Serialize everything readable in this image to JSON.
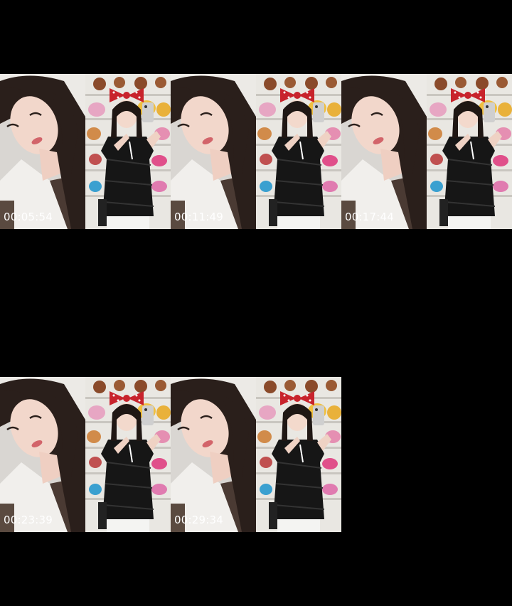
{
  "thumbnails": [
    {
      "timestamp": "00:05:54"
    },
    {
      "timestamp": "00:11:49"
    },
    {
      "timestamp": "00:17:44"
    },
    {
      "timestamp": "00:23:39"
    },
    {
      "timestamp": "00:29:34"
    }
  ],
  "colors": {
    "background": "#000000",
    "timestamp_text": "#ffffff",
    "bow_red": "#c8232c",
    "top_black": "#161616",
    "shelf_wall": "#e9e7e2"
  }
}
